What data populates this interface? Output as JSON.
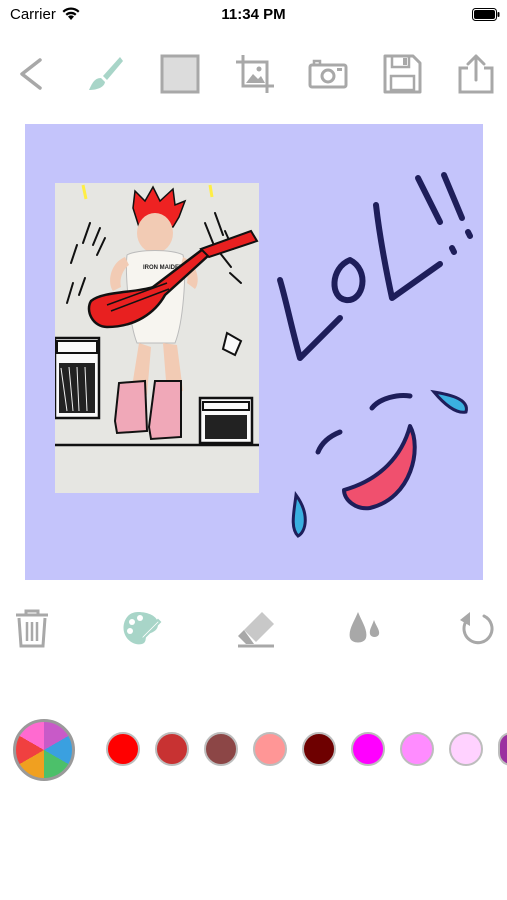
{
  "status_bar": {
    "carrier": "Carrier",
    "time": "11:34 PM"
  },
  "toolbar": {
    "items": [
      {
        "icon": "back-chevron-icon"
      },
      {
        "icon": "brush-icon",
        "color": "#a8d5c8"
      },
      {
        "icon": "background-square-icon"
      },
      {
        "icon": "crop-image-icon"
      },
      {
        "icon": "camera-icon"
      },
      {
        "icon": "save-floppy-icon"
      },
      {
        "icon": "share-icon"
      }
    ]
  },
  "canvas": {
    "background": "#c4c4fb",
    "photo_caption": "IRON MAIDEN"
  },
  "tools": {
    "items": [
      {
        "icon": "trash-icon"
      },
      {
        "icon": "palette-icon",
        "color": "#a8d5c8"
      },
      {
        "icon": "eraser-icon"
      },
      {
        "icon": "opacity-drops-icon"
      },
      {
        "icon": "undo-icon"
      }
    ]
  },
  "palette": {
    "swatches": [
      "#ff0000",
      "#c83232",
      "#8c4646",
      "#ff9696",
      "#6e0000",
      "#ff00ff",
      "#ff8cff",
      "#ffd2ff",
      "#9b30a0"
    ]
  }
}
